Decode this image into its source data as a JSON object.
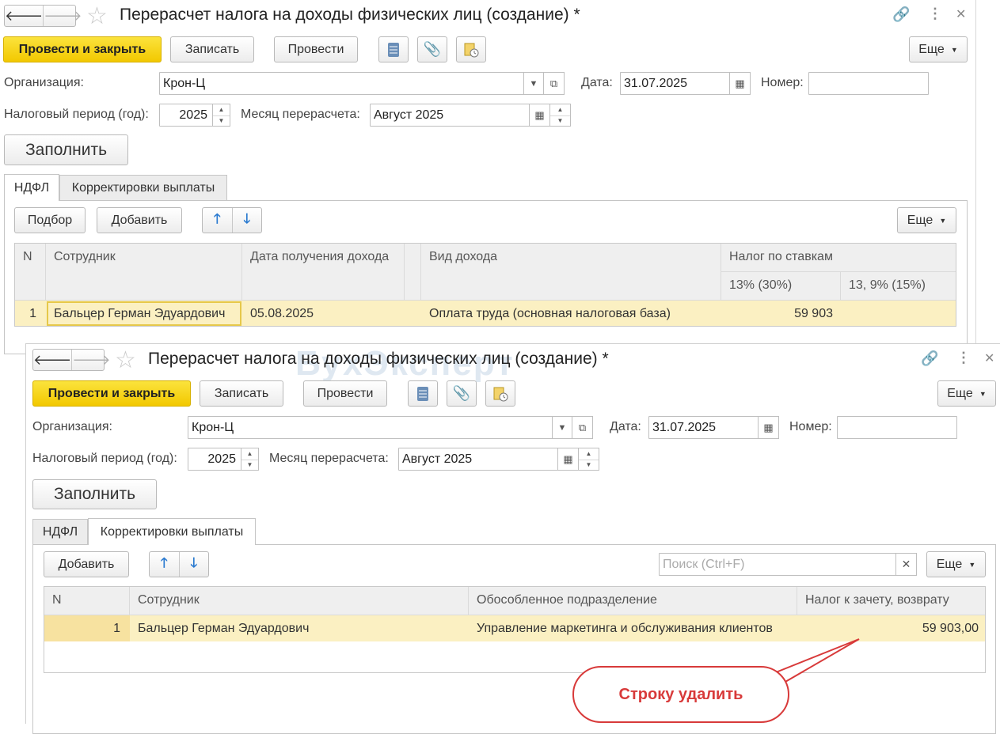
{
  "window1": {
    "title": "Перерасчет налога на доходы физических лиц (создание) *",
    "toolbar": {
      "post_close": "Провести и закрыть",
      "save": "Записать",
      "post": "Провести",
      "more": "Еще"
    },
    "org_label": "Организация:",
    "org_value": "Крон-Ц",
    "date_label": "Дата:",
    "date_value": "31.07.2025",
    "number_label": "Номер:",
    "number_value": "",
    "period_label": "Налоговый период (год):",
    "period_value": "2025",
    "month_label": "Месяц перерасчета:",
    "month_value": "Август 2025",
    "fill_button": "Заполнить",
    "tabs": [
      "НДФЛ",
      "Корректировки выплаты"
    ],
    "table_toolbar": {
      "pick": "Подбор",
      "add": "Добавить",
      "more": "Еще"
    },
    "table": {
      "col_n": "N",
      "col_employee": "Сотрудник",
      "col_date": "Дата получения дохода",
      "col_income": "Вид дохода",
      "col_tax": "Налог по ставкам",
      "col_tax_13": "13% (30%)",
      "col_tax_13_9": "13, 9% (15%)",
      "rows": [
        {
          "n": "1",
          "employee": "Бальцер Герман Эдуардович",
          "date": "05.08.2025",
          "income": "Оплата труда (основная налоговая база)",
          "tax13": "59 903",
          "tax13_9": ""
        }
      ]
    }
  },
  "window2": {
    "title": "Перерасчет налога на доходы физических лиц (создание) *",
    "toolbar": {
      "post_close": "Провести и закрыть",
      "save": "Записать",
      "post": "Провести",
      "more": "Еще"
    },
    "org_label": "Организация:",
    "org_value": "Крон-Ц",
    "date_label": "Дата:",
    "date_value": "31.07.2025",
    "number_label": "Номер:",
    "number_value": "",
    "period_label": "Налоговый период (год):",
    "period_value": "2025",
    "month_label": "Месяц перерасчета:",
    "month_value": "Август 2025",
    "fill_button": "Заполнить",
    "tabs": [
      "НДФЛ",
      "Корректировки выплаты"
    ],
    "table_toolbar": {
      "add": "Добавить",
      "search_placeholder": "Поиск (Ctrl+F)",
      "more": "Еще"
    },
    "table": {
      "col_n": "N",
      "col_employee": "Сотрудник",
      "col_department": "Обособленное подразделение",
      "col_tax": "Налог к зачету, возврату",
      "rows": [
        {
          "n": "1",
          "employee": "Бальцер Герман Эдуардович",
          "department": "Управление маркетинга и обслуживания клиентов",
          "tax": "59 903,00"
        }
      ]
    }
  },
  "callout": {
    "text": "Строку удалить",
    "color": "#d83a3a"
  },
  "watermark": "БухЭксперт",
  "colors": {
    "primary_button": "#f5d20a",
    "selected_row": "#fbf0c2",
    "arrow_blue": "#2a7ad0"
  }
}
